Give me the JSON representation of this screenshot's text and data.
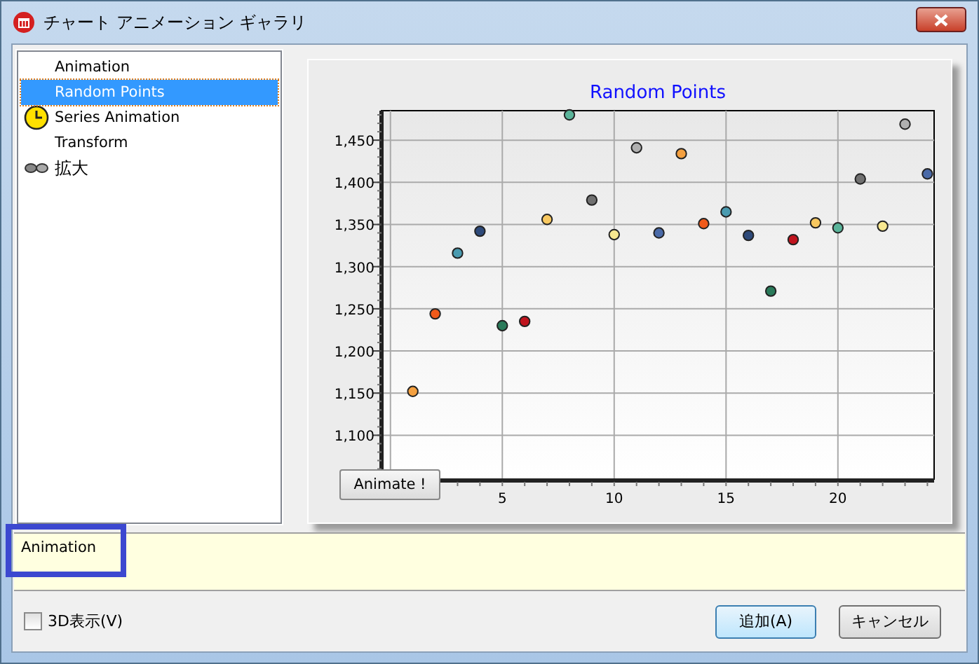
{
  "window": {
    "title": "チャート アニメーション ギャラリ"
  },
  "tree": {
    "items": [
      {
        "label": "Animation",
        "kind": "plain",
        "selected": false
      },
      {
        "label": "Random Points",
        "kind": "plain",
        "selected": true
      },
      {
        "label": "Series Animation",
        "kind": "clock",
        "selected": false
      },
      {
        "label": "Transform",
        "kind": "plain",
        "selected": false
      },
      {
        "label": "拡大",
        "kind": "glasses",
        "selected": false
      }
    ]
  },
  "chart": {
    "animate_button": "Animate !",
    "chart_data": {
      "type": "scatter",
      "title": "Random Points",
      "x": [
        1,
        2,
        3,
        4,
        5,
        6,
        7,
        8,
        9,
        10,
        11,
        12,
        13,
        14,
        15,
        16,
        17,
        18,
        19,
        20,
        21,
        22,
        23,
        24
      ],
      "grid": true,
      "series": [
        {
          "color": "#f4a040",
          "values": [
            1152,
            null,
            null,
            null,
            null,
            null,
            null,
            null,
            null,
            null,
            null,
            null,
            1434,
            null,
            null,
            null,
            null,
            null,
            null,
            null,
            null,
            null,
            null,
            null
          ]
        },
        {
          "color": "#f05a1a",
          "values": [
            null,
            1244,
            null,
            null,
            null,
            null,
            null,
            null,
            null,
            null,
            null,
            null,
            null,
            1351,
            null,
            null,
            null,
            null,
            null,
            null,
            null,
            null,
            null,
            null
          ]
        },
        {
          "color": "#4a9bb0",
          "values": [
            null,
            null,
            1316,
            null,
            null,
            null,
            null,
            null,
            null,
            null,
            null,
            null,
            null,
            null,
            1365,
            null,
            null,
            null,
            null,
            null,
            null,
            null,
            null,
            null
          ]
        },
        {
          "color": "#2e4a7a",
          "values": [
            null,
            null,
            null,
            1342,
            null,
            null,
            null,
            null,
            null,
            null,
            null,
            null,
            null,
            null,
            null,
            1337,
            null,
            null,
            null,
            null,
            null,
            null,
            null,
            null
          ]
        },
        {
          "color": "#2a7a5a",
          "values": [
            null,
            null,
            null,
            null,
            1230,
            null,
            null,
            null,
            null,
            null,
            null,
            null,
            null,
            null,
            null,
            null,
            1271,
            null,
            null,
            null,
            null,
            null,
            null,
            null
          ]
        },
        {
          "color": "#c0141e",
          "values": [
            null,
            null,
            null,
            null,
            null,
            1235,
            null,
            null,
            null,
            null,
            null,
            null,
            null,
            null,
            null,
            null,
            null,
            1332,
            null,
            null,
            null,
            null,
            null,
            null
          ]
        },
        {
          "color": "#f8c860",
          "values": [
            null,
            null,
            null,
            null,
            null,
            null,
            1356,
            null,
            null,
            null,
            null,
            null,
            null,
            null,
            null,
            null,
            null,
            null,
            1352,
            null,
            null,
            null,
            null,
            null
          ]
        },
        {
          "color": "#5ab49a",
          "values": [
            null,
            null,
            null,
            null,
            null,
            null,
            null,
            1480,
            null,
            null,
            null,
            null,
            null,
            null,
            null,
            null,
            null,
            null,
            null,
            1346,
            null,
            null,
            null,
            null
          ]
        },
        {
          "color": "#707070",
          "values": [
            null,
            null,
            null,
            null,
            null,
            null,
            null,
            null,
            1379,
            null,
            null,
            null,
            null,
            null,
            null,
            null,
            null,
            null,
            null,
            null,
            1404,
            null,
            null,
            null
          ]
        },
        {
          "color": "#f8e890",
          "values": [
            null,
            null,
            null,
            null,
            null,
            null,
            null,
            null,
            null,
            1338,
            null,
            null,
            null,
            null,
            null,
            null,
            null,
            null,
            null,
            null,
            null,
            1348,
            null,
            null
          ]
        },
        {
          "color": "#b0b0b0",
          "values": [
            null,
            null,
            null,
            null,
            null,
            null,
            null,
            null,
            null,
            null,
            1441,
            null,
            null,
            null,
            null,
            null,
            null,
            null,
            null,
            null,
            null,
            null,
            1469,
            null
          ]
        },
        {
          "color": "#4a6aa8",
          "values": [
            null,
            null,
            null,
            null,
            null,
            null,
            null,
            null,
            null,
            null,
            null,
            1340,
            null,
            null,
            null,
            null,
            null,
            null,
            null,
            null,
            null,
            null,
            null,
            1410
          ]
        }
      ],
      "xlim": [
        -0.4,
        24.3
      ],
      "ylim": [
        1048,
        1485
      ],
      "xticks": [
        5,
        10,
        15,
        20
      ],
      "yticks": [
        {
          "value": 1100,
          "label": "1,100"
        },
        {
          "value": 1150,
          "label": "1,150"
        },
        {
          "value": 1200,
          "label": "1,200"
        },
        {
          "value": 1250,
          "label": "1,250"
        },
        {
          "value": 1300,
          "label": "1,300"
        },
        {
          "value": 1350,
          "label": "1,350"
        },
        {
          "value": 1400,
          "label": "1,400"
        },
        {
          "value": 1450,
          "label": "1,450"
        }
      ]
    }
  },
  "description": {
    "text": "Animation"
  },
  "footer": {
    "checkbox": {
      "label": "3D表示(V)",
      "checked": false
    },
    "buttons": [
      {
        "label": "追加(A)",
        "default": true
      },
      {
        "label": "キャンセル",
        "default": false
      }
    ]
  }
}
